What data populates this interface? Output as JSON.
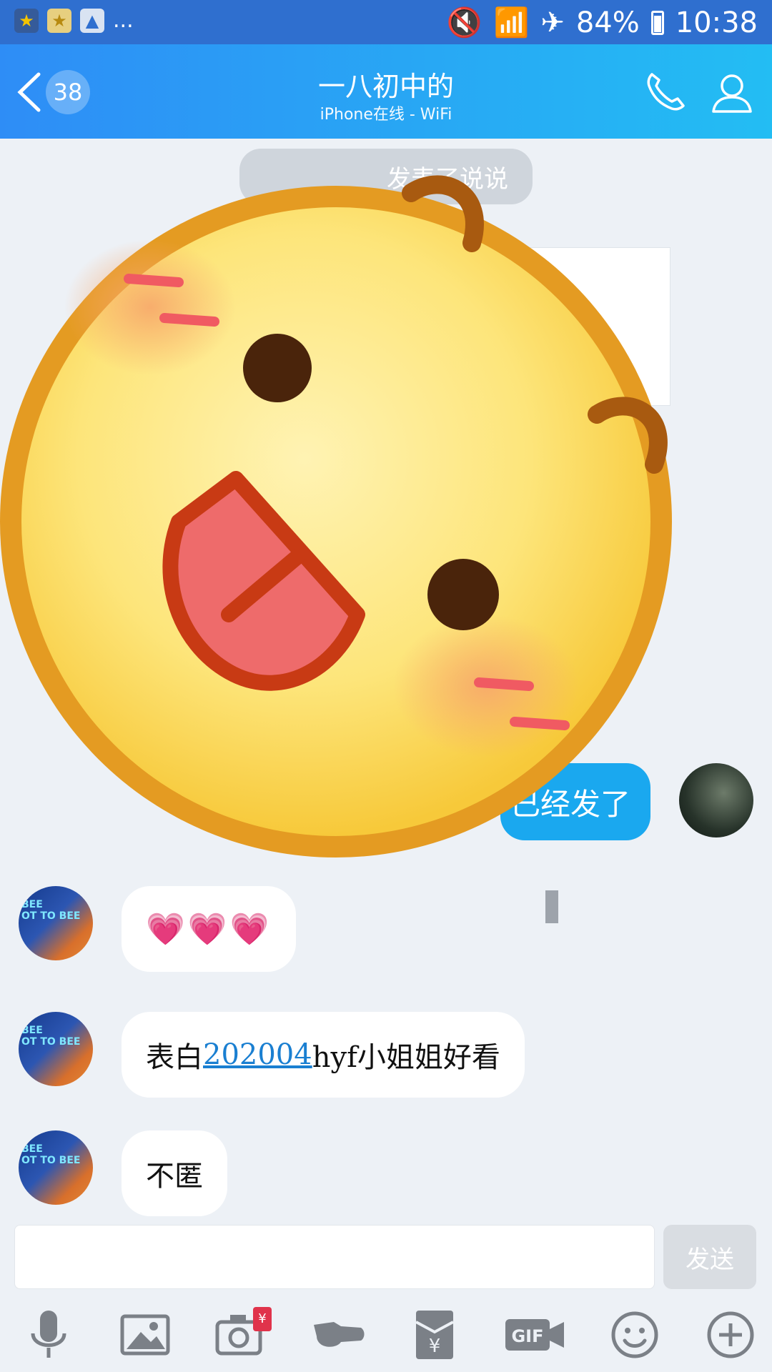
{
  "status_bar": {
    "notification_icons": [
      "star-icon",
      "gold-star-icon",
      "image-icon"
    ],
    "overflow": "...",
    "battery": "84%",
    "time": "10:38",
    "icons": [
      "mute-icon",
      "wifi-icon",
      "airplane-icon",
      "battery-icon"
    ]
  },
  "header": {
    "unread_count": "38",
    "title": "一八初中的",
    "subtitle": "iPhone在线 - WiFi",
    "accent": "#2e8df6"
  },
  "chat": {
    "system_pill": "发表了说说",
    "my_message": "已经发了",
    "messages": [
      {
        "text": "💗💗💗"
      },
      {
        "prefix": "表白 ",
        "link": "202004",
        "suffix": "hyf小姐姐好看"
      },
      {
        "text": "不匿"
      }
    ],
    "sticker": "tongue-out-emoji-sticker"
  },
  "composer": {
    "send_label": "发送"
  },
  "toolbar": {
    "items": [
      "microphone-icon",
      "image-icon",
      "camera-icon",
      "poke-icon",
      "red-envelope-icon",
      "gif-icon",
      "emoji-icon",
      "plus-icon"
    ],
    "camera_badge": "¥"
  }
}
